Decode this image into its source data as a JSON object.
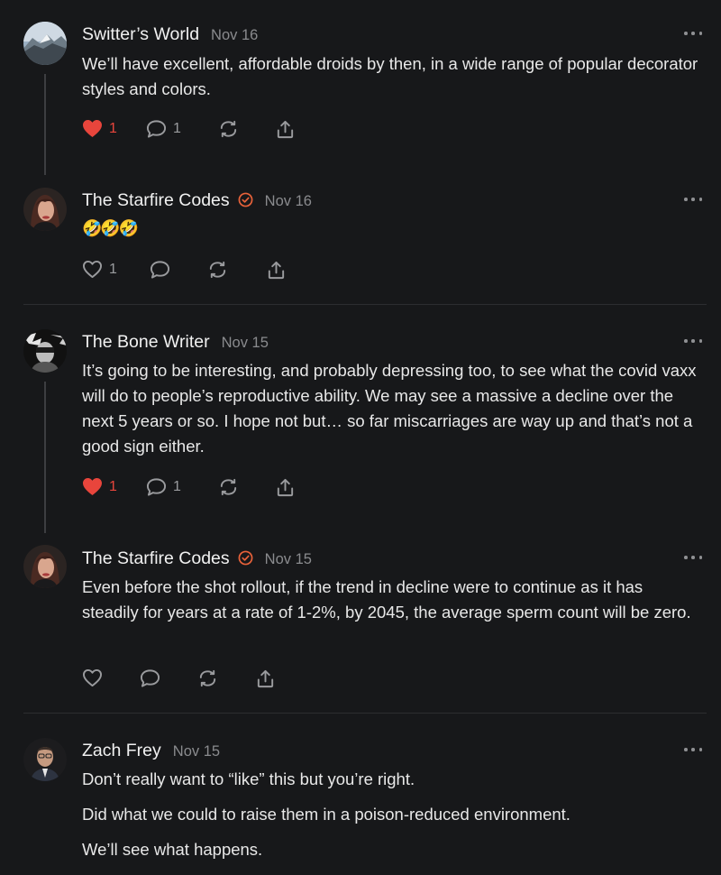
{
  "comments": [
    {
      "author": "Switter’s World",
      "date": "Nov 16",
      "paragraphs": [
        "We’ll have excellent, affordable droids by then, in a wide range of popular decorator styles and colors."
      ],
      "like_count": "1",
      "liked": true,
      "reply_count": "1"
    },
    {
      "author": "The Starfire Codes",
      "date": "Nov 16",
      "verified": true,
      "paragraphs": [
        "🤣🤣🤣"
      ],
      "like_count": "1",
      "liked": false,
      "reply_count": ""
    },
    {
      "author": "The Bone Writer",
      "date": "Nov 15",
      "paragraphs": [
        "It’s going to be interesting, and probably depressing too, to see what the covid vaxx will do to people’s reproductive ability. We may see a massive a decline over the next 5 years or so. I hope not but… so far miscarriages are way up and that’s not a good sign either."
      ],
      "like_count": "1",
      "liked": true,
      "reply_count": "1"
    },
    {
      "author": "The Starfire Codes",
      "date": "Nov 15",
      "verified": true,
      "paragraphs": [
        "Even before the shot rollout, if the trend in decline were to continue as it has steadily for years at a rate of 1-2%, by 2045, the average sperm count will be zero."
      ],
      "like_count": "",
      "liked": false,
      "reply_count": ""
    },
    {
      "author": "Zach Frey",
      "date": "Nov 15",
      "paragraphs": [
        "Don’t really want to “like” this but you’re right.",
        "Did what we could to raise them in a poison-reduced environment.",
        "We’ll see what happens."
      ]
    }
  ],
  "colors": {
    "background": "#17181a",
    "accent_orange": "#e8623a",
    "like_red": "#e8453c"
  },
  "icons": [
    "heart-icon",
    "comment-icon",
    "restack-icon",
    "share-icon",
    "more-icon",
    "verified-icon"
  ]
}
